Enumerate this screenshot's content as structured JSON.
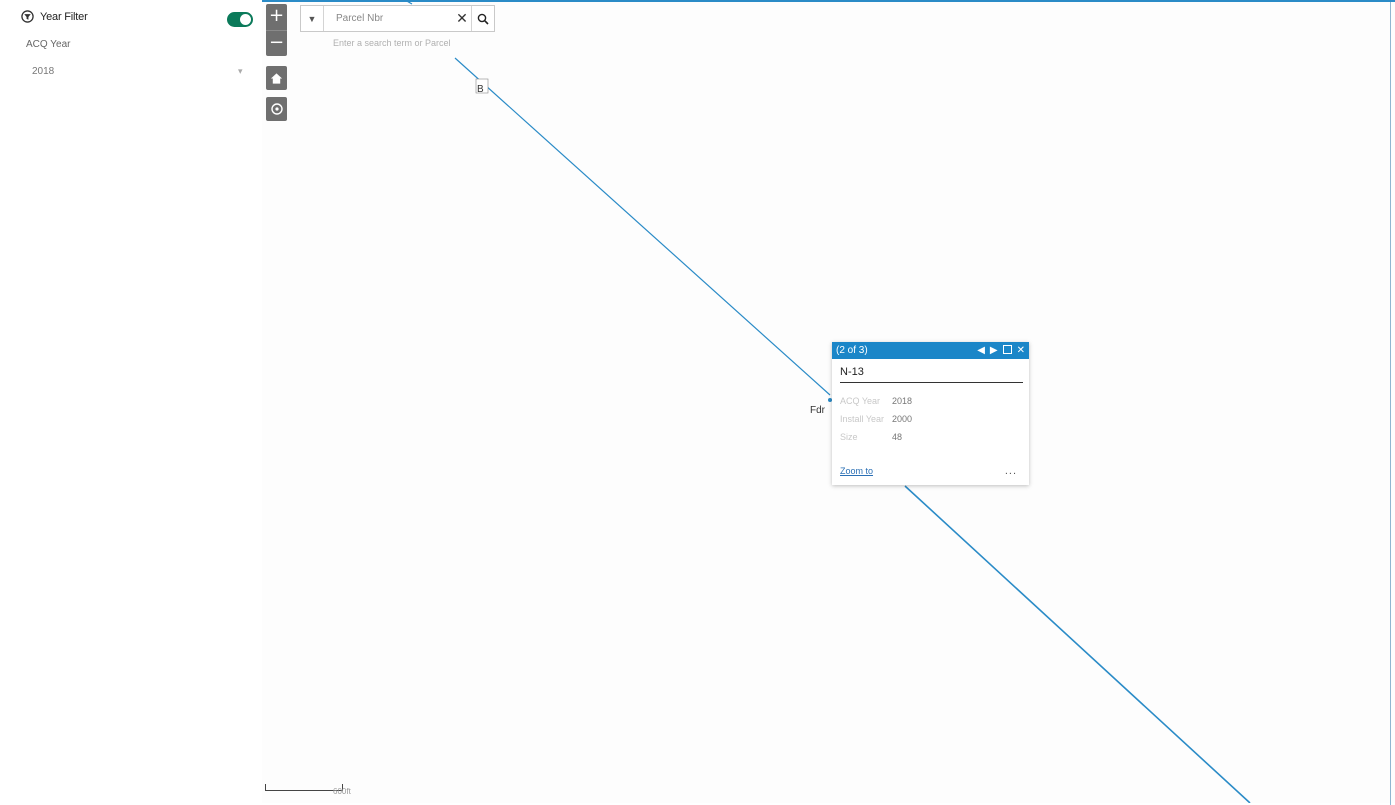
{
  "colors": {
    "accent": "#1b86c8",
    "toggle_on": "#0b7a5a",
    "line": "#2a8bc7",
    "control_bg": "#6f6f6f"
  },
  "sidebar": {
    "filter_title": "Year Filter",
    "filter_icon": "filter-icon",
    "toggle_state": "on",
    "field_label": "ACQ Year",
    "field_value": "2018"
  },
  "map": {
    "controls": {
      "zoom_in": "+",
      "zoom_out": "−",
      "home_icon": "home-icon",
      "locate_icon": "locate-icon"
    },
    "search": {
      "value": "Parcel Nbr",
      "hint": "Enter a search term or Parcel"
    },
    "labels": {
      "node": "B",
      "feature": "Fdr"
    },
    "scale_label": "600ft",
    "popup": {
      "counter": "(2 of 3)",
      "title": "N-13",
      "rows": [
        {
          "key": "ACQ Year",
          "value": "2018"
        },
        {
          "key": "Install Year",
          "value": "2000"
        },
        {
          "key": "Size",
          "value": "48"
        }
      ],
      "zoom_to": "Zoom to",
      "more": "..."
    }
  }
}
